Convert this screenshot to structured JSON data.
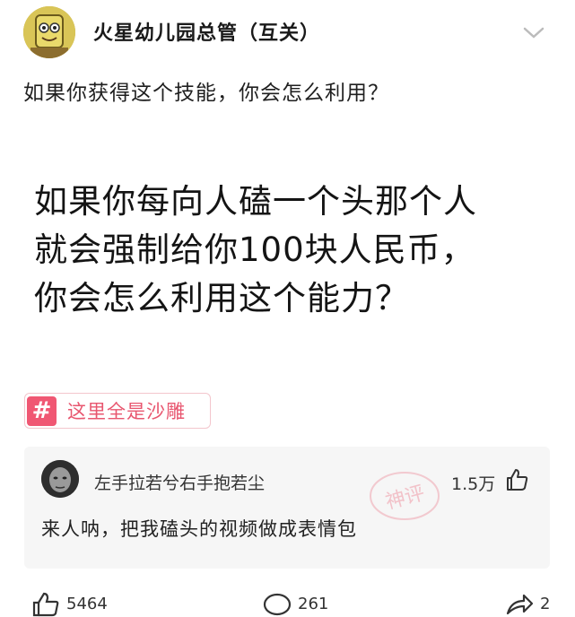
{
  "header": {
    "author_name": "火星幼儿园总管（互关）",
    "avatar_icon": "yellow-cartoon-avatar-icon",
    "menu_icon": "chevron-down-icon"
  },
  "post": {
    "question": "如果你获得这个技能，你会怎么利用？",
    "image_text": {
      "line1": "如果你每向人磕一个头那个人",
      "line2": "就会强制给你100块人民币，",
      "line3": "你会怎么利用这个能力？"
    },
    "tag": {
      "icon": "#",
      "label": "这里全是沙雕",
      "color": "#f05773"
    }
  },
  "top_comment": {
    "username": "左手拉若兮右手抱若尘",
    "likes": "1.5万",
    "text": "来人呐，把我磕头的视频做成表情包",
    "stamp_text": "神评",
    "like_icon": "thumbs-up-icon"
  },
  "footer": {
    "likes": "5464",
    "comments": "261",
    "shares": "2"
  }
}
